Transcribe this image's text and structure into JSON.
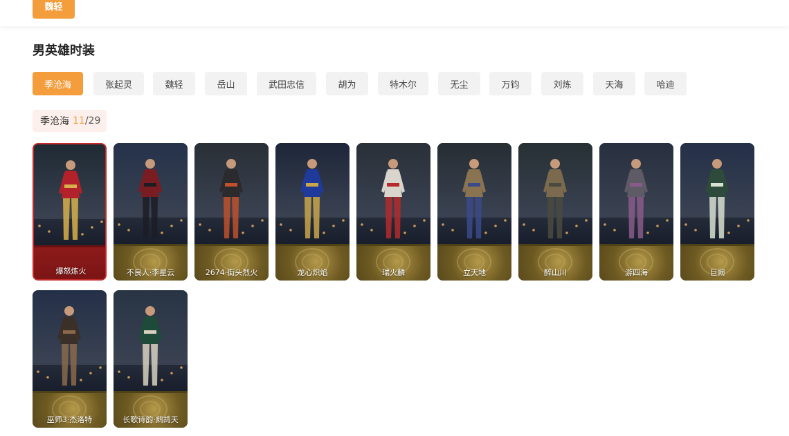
{
  "top_chip": {
    "label": "魏轻"
  },
  "section_title": "男英雄时装",
  "tabs": [
    {
      "label": "季沧海",
      "active": true
    },
    {
      "label": "张起灵",
      "active": false
    },
    {
      "label": "魏轻",
      "active": false
    },
    {
      "label": "岳山",
      "active": false
    },
    {
      "label": "武田忠信",
      "active": false
    },
    {
      "label": "胡为",
      "active": false
    },
    {
      "label": "特木尔",
      "active": false
    },
    {
      "label": "无尘",
      "active": false
    },
    {
      "label": "万钧",
      "active": false
    },
    {
      "label": "刘炼",
      "active": false
    },
    {
      "label": "天海",
      "active": false
    },
    {
      "label": "哈迪",
      "active": false
    }
  ],
  "counter": {
    "hero": "季沧海",
    "current": "11",
    "separator": "/",
    "total": "29"
  },
  "skins": [
    {
      "name": "爆怒炼火",
      "selected": true,
      "bg_top": "#1f2a33",
      "body": "#b3222a",
      "accent": "#d8b04a"
    },
    {
      "name": "不良人·李星云",
      "selected": false,
      "bg_top": "#25324a",
      "body": "#7a1d22",
      "accent": "#1c1c24"
    },
    {
      "name": "2674·街头烈火",
      "selected": false,
      "bg_top": "#2a2f36",
      "body": "#2b2b2e",
      "accent": "#c0502a"
    },
    {
      "name": "龙心炽焰",
      "selected": false,
      "bg_top": "#1d2638",
      "body": "#1f3a9a",
      "accent": "#c9a64a"
    },
    {
      "name": "瑞火麟",
      "selected": false,
      "bg_top": "#2a3038",
      "body": "#d9d4cc",
      "accent": "#b52a2a"
    },
    {
      "name": "立天地",
      "selected": false,
      "bg_top": "#262d33",
      "body": "#8a7350",
      "accent": "#3a4a8a"
    },
    {
      "name": "醉山川",
      "selected": false,
      "bg_top": "#263034",
      "body": "#7b6a4e",
      "accent": "#4a4a3e"
    },
    {
      "name": "游四海",
      "selected": false,
      "bg_top": "#283040",
      "body": "#5e5a66",
      "accent": "#8a5a8a"
    },
    {
      "name": "巨阙",
      "selected": false,
      "bg_top": "#243048",
      "body": "#2e4a3a",
      "accent": "#d8e0d0"
    },
    {
      "name": "巫师3·杰洛特",
      "selected": false,
      "bg_top": "#243048",
      "body": "#3a3028",
      "accent": "#8a6a4a"
    },
    {
      "name": "长歌诗韵·鹧鸪天",
      "selected": false,
      "bg_top": "#283444",
      "body": "#1e4a3a",
      "accent": "#d8d0c0"
    }
  ]
}
